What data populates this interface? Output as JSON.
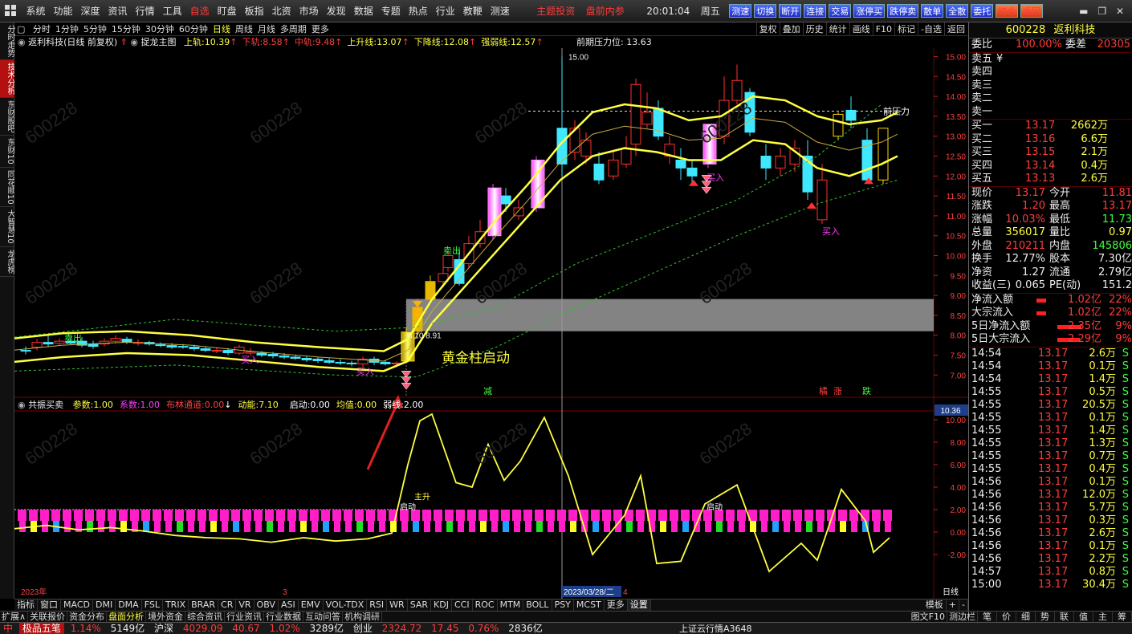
{
  "menu": {
    "items": [
      "系统",
      "功能",
      "深度",
      "资讯",
      "行情",
      "工具",
      "自选",
      "盯盘",
      "板指",
      "北资",
      "市场",
      "发现",
      "数据",
      "专题",
      "热点",
      "行业",
      "教鞭",
      "测速"
    ],
    "active_index": 6,
    "red_texts": [
      "主题投资",
      "盘前内参"
    ],
    "time": "20:01:04",
    "weekday": "周五",
    "buttons": [
      "测速",
      "切换",
      "断开",
      "连接",
      "交易",
      "涨停买",
      "跌停卖",
      "散单",
      "全散",
      "委托",
      "持仓",
      "返回"
    ]
  },
  "left_tabs": [
    "分时走势",
    "技术分析",
    "东财股吧",
    "东财10",
    "同花顺10",
    "大智慧10",
    "龙虎榜"
  ],
  "left_tab_active": 1,
  "periods": [
    "分时",
    "1分钟",
    "5分钟",
    "15分钟",
    "30分钟",
    "60分钟",
    "日线",
    "周线",
    "月线",
    "多周期",
    "更多"
  ],
  "period_active": 6,
  "tools": [
    "复权",
    "叠加",
    "历史",
    "统计",
    "画线",
    "F10",
    "标记",
    "-自选",
    "返回"
  ],
  "main_legend": {
    "title": "返利科技(日线 前复权)",
    "indicator": "捉龙主图",
    "items": [
      {
        "label": "上轨:",
        "value": "10.39",
        "color": "#ffff40"
      },
      {
        "label": "下轨:",
        "value": "8.58",
        "color": "#ff4040"
      },
      {
        "label": "中轨:",
        "value": "9.48",
        "color": "#ff4040"
      },
      {
        "label": "上升线:",
        "value": "13.07",
        "color": "#ffff40"
      },
      {
        "label": "下降线:",
        "value": "12.08",
        "color": "#ffff40"
      },
      {
        "label": "强弱线:",
        "value": "12.57",
        "color": "#ffff40"
      }
    ],
    "pressure": "前期压力位: 13.63"
  },
  "chart_data": {
    "type": "candlestick",
    "price_ticks": [
      "15.00",
      "14.50",
      "14.00",
      "13.50",
      "13.00",
      "12.50",
      "12.00",
      "11.50",
      "11.00",
      "10.50",
      "10.00",
      "9.50",
      "9.00",
      "8.50",
      "8.00",
      "7.50",
      "7.00"
    ],
    "sub_ticks": [
      "10.00",
      "8.00",
      "6.00",
      "4.00",
      "2.00",
      "0.00",
      "-2.00"
    ],
    "sub_badge": "10.36",
    "annotations": {
      "high": "15.00",
      "pressure": "前压力",
      "launch": "黄金柱启动",
      "buy": "买入",
      "sell": "卖出",
      "box_prices": "8.10  8.91",
      "main_rise": "主升",
      "start": "启动"
    },
    "bottom_markers": [
      "减",
      "橘",
      "涨",
      "跌"
    ],
    "x_labels": [
      "2023年",
      "3",
      "2023/03/28/二",
      "4"
    ]
  },
  "sub_legend": {
    "name": "共振买卖",
    "items": [
      {
        "label": "参数:",
        "value": "1.00",
        "color": "#ffff40"
      },
      {
        "label": "系数:",
        "value": "1.00",
        "color": "#ff40ff"
      },
      {
        "label": "布林通道:",
        "value": "0.00",
        "color": "#ff4040"
      },
      {
        "label": "动能:",
        "value": "7.10",
        "color": "#ffff40"
      },
      {
        "label": "启动:",
        "value": "0.00",
        "color": "#ffffff"
      },
      {
        "label": "均值:",
        "value": "0.00",
        "color": "#ffff40"
      },
      {
        "label": "弱线:",
        "value": "2.00",
        "color": "#ffffff"
      }
    ]
  },
  "indicator_tabs": [
    "指标",
    "窗口",
    "MACD",
    "DMI",
    "DMA",
    "FSL",
    "TRIX",
    "BRAR",
    "CR",
    "VR",
    "OBV",
    "ASI",
    "EMV",
    "VOL-TDX",
    "RSI",
    "WR",
    "SAR",
    "KDJ",
    "CCI",
    "ROC",
    "MTM",
    "BOLL",
    "PSY",
    "MCST",
    "更多",
    "设置"
  ],
  "indicator_right": [
    "模板",
    "+",
    "-"
  ],
  "bottom_tabs": [
    "扩展∧",
    "关联报价",
    "资金分布",
    "盘面分析",
    "境外资金",
    "综合资讯",
    "行业资讯",
    "行业数据",
    "互动问答",
    "机构调研"
  ],
  "bottom_right": [
    "图文F10",
    "测边栏",
    "笔",
    "价",
    "细",
    "势",
    "联",
    "值",
    "主",
    "筹"
  ],
  "day_label": "日线",
  "status": {
    "brand": "极品五笔",
    "pct1": "1.14%",
    "amt1": "5149亿",
    "idx2_name": "沪深",
    "idx2": "4029.09",
    "idx2_chg": "40.67",
    "idx2_pct": "1.02%",
    "amt2": "3289亿",
    "idx3_name": "创业",
    "idx3": "2324.72",
    "idx3_chg": "17.45",
    "idx3_pct": "0.76%",
    "amt3": "2836亿",
    "msg": "上证云行情A3648"
  },
  "stock": {
    "code": "600228",
    "name": "返利科技",
    "webi_label": "委比",
    "webi": "100.00%",
    "weicha_label": "委差",
    "weicha": "20305",
    "sells": [
      {
        "label": "卖五",
        "price": "¥"
      },
      {
        "label": "卖四",
        "price": ""
      },
      {
        "label": "卖三",
        "price": ""
      },
      {
        "label": "卖二",
        "price": ""
      },
      {
        "label": "卖一",
        "price": ""
      }
    ],
    "buys": [
      {
        "label": "买一",
        "price": "13.17",
        "vol": "2662万"
      },
      {
        "label": "买二",
        "price": "13.16",
        "vol": "6.6万"
      },
      {
        "label": "买三",
        "price": "13.15",
        "vol": "2.1万"
      },
      {
        "label": "买四",
        "price": "13.14",
        "vol": "0.4万"
      },
      {
        "label": "买五",
        "price": "13.13",
        "vol": "2.6万"
      }
    ],
    "stats": [
      [
        "现价",
        "13.17",
        "今开",
        "11.81"
      ],
      [
        "涨跌",
        "1.20",
        "最高",
        "13.17"
      ],
      [
        "涨幅",
        "10.03%",
        "最低",
        "11.73"
      ],
      [
        "总量",
        "356017",
        "量比",
        "0.97"
      ],
      [
        "外盘",
        "210211",
        "内盘",
        "145806"
      ],
      [
        "换手",
        "12.77%",
        "股本",
        "7.30亿"
      ],
      [
        "净资",
        "1.27",
        "流通",
        "2.79亿"
      ],
      [
        "收益(三)",
        "0.065",
        "PE(动)",
        "151.2"
      ]
    ],
    "flows": [
      [
        "净流入额",
        "1.02亿",
        "22%"
      ],
      [
        "大宗流入",
        "1.02亿",
        "22%"
      ],
      [
        "5日净流入额",
        "2.35亿",
        "9%"
      ],
      [
        "5日大宗流入",
        "2.29亿",
        "9%"
      ]
    ],
    "ticks": [
      [
        "14:54",
        "13.17",
        "2.6万",
        "S"
      ],
      [
        "14:54",
        "13.17",
        "0.1万",
        "S"
      ],
      [
        "14:54",
        "13.17",
        "1.4万",
        "S"
      ],
      [
        "14:55",
        "13.17",
        "0.5万",
        "S"
      ],
      [
        "14:55",
        "13.17",
        "20.5万",
        "S"
      ],
      [
        "14:55",
        "13.17",
        "0.1万",
        "S"
      ],
      [
        "14:55",
        "13.17",
        "1.4万",
        "S"
      ],
      [
        "14:55",
        "13.17",
        "1.3万",
        "S"
      ],
      [
        "14:55",
        "13.17",
        "0.7万",
        "S"
      ],
      [
        "14:55",
        "13.17",
        "0.4万",
        "S"
      ],
      [
        "14:56",
        "13.17",
        "0.1万",
        "S"
      ],
      [
        "14:56",
        "13.17",
        "12.0万",
        "S"
      ],
      [
        "14:56",
        "13.17",
        "5.7万",
        "S"
      ],
      [
        "14:56",
        "13.17",
        "0.3万",
        "S"
      ],
      [
        "14:56",
        "13.17",
        "2.6万",
        "S"
      ],
      [
        "14:56",
        "13.17",
        "0.1万",
        "S"
      ],
      [
        "14:56",
        "13.17",
        "2.2万",
        "S"
      ],
      [
        "14:57",
        "13.17",
        "0.8万",
        "S"
      ],
      [
        "15:00",
        "13.17",
        "30.4万",
        "S"
      ]
    ]
  }
}
